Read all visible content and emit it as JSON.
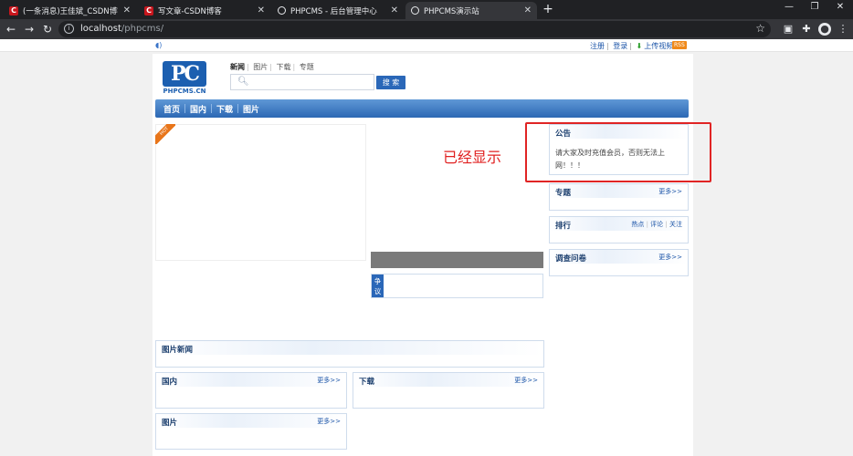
{
  "browser": {
    "tabs": [
      {
        "title": "(一条消息)王佳斌_CSDN博客-",
        "icon": "csdn-icon",
        "active": false
      },
      {
        "title": "写文章-CSDN博客",
        "icon": "csdn-icon",
        "active": false
      },
      {
        "title": "PHPCMS - 后台管理中心",
        "icon": "globe-icon",
        "active": false
      },
      {
        "title": "PHPCMS演示站",
        "icon": "globe-icon",
        "active": true
      }
    ],
    "url_host": "localhost",
    "url_path": "/phpcms/"
  },
  "topbar": {
    "register": "注册",
    "separator": "|",
    "login": "登录",
    "upload_video": "上传视频",
    "rss": "RSS"
  },
  "logo": {
    "mark": "PC",
    "name": "PHPCMS.CN"
  },
  "search": {
    "tabs": [
      "新闻",
      "图片",
      "下载",
      "专题"
    ],
    "active_tab": "新闻",
    "button": "搜 索",
    "value": ""
  },
  "nav": [
    "首页",
    "国内",
    "下载",
    "图片"
  ],
  "hot_badge": "HOT",
  "vote_label": "争议",
  "annotation": "已经显示",
  "sidebar": {
    "notice_title": "公告",
    "notice_text": "请大家及时充值会员，否则无法上网！！！",
    "topic_title": "专题",
    "rank_title": "排行",
    "rank_tabs": [
      "热点",
      "评论",
      "关注"
    ],
    "survey_title": "调查问卷",
    "more": "更多>>"
  },
  "main": {
    "picnews_title": "图片新闻",
    "domestic_title": "国内",
    "download_title": "下载",
    "picture_title": "图片",
    "more": "更多>>"
  },
  "colors": {
    "nav_blue": "#2c68b4",
    "annotation_red": "#e02020"
  }
}
